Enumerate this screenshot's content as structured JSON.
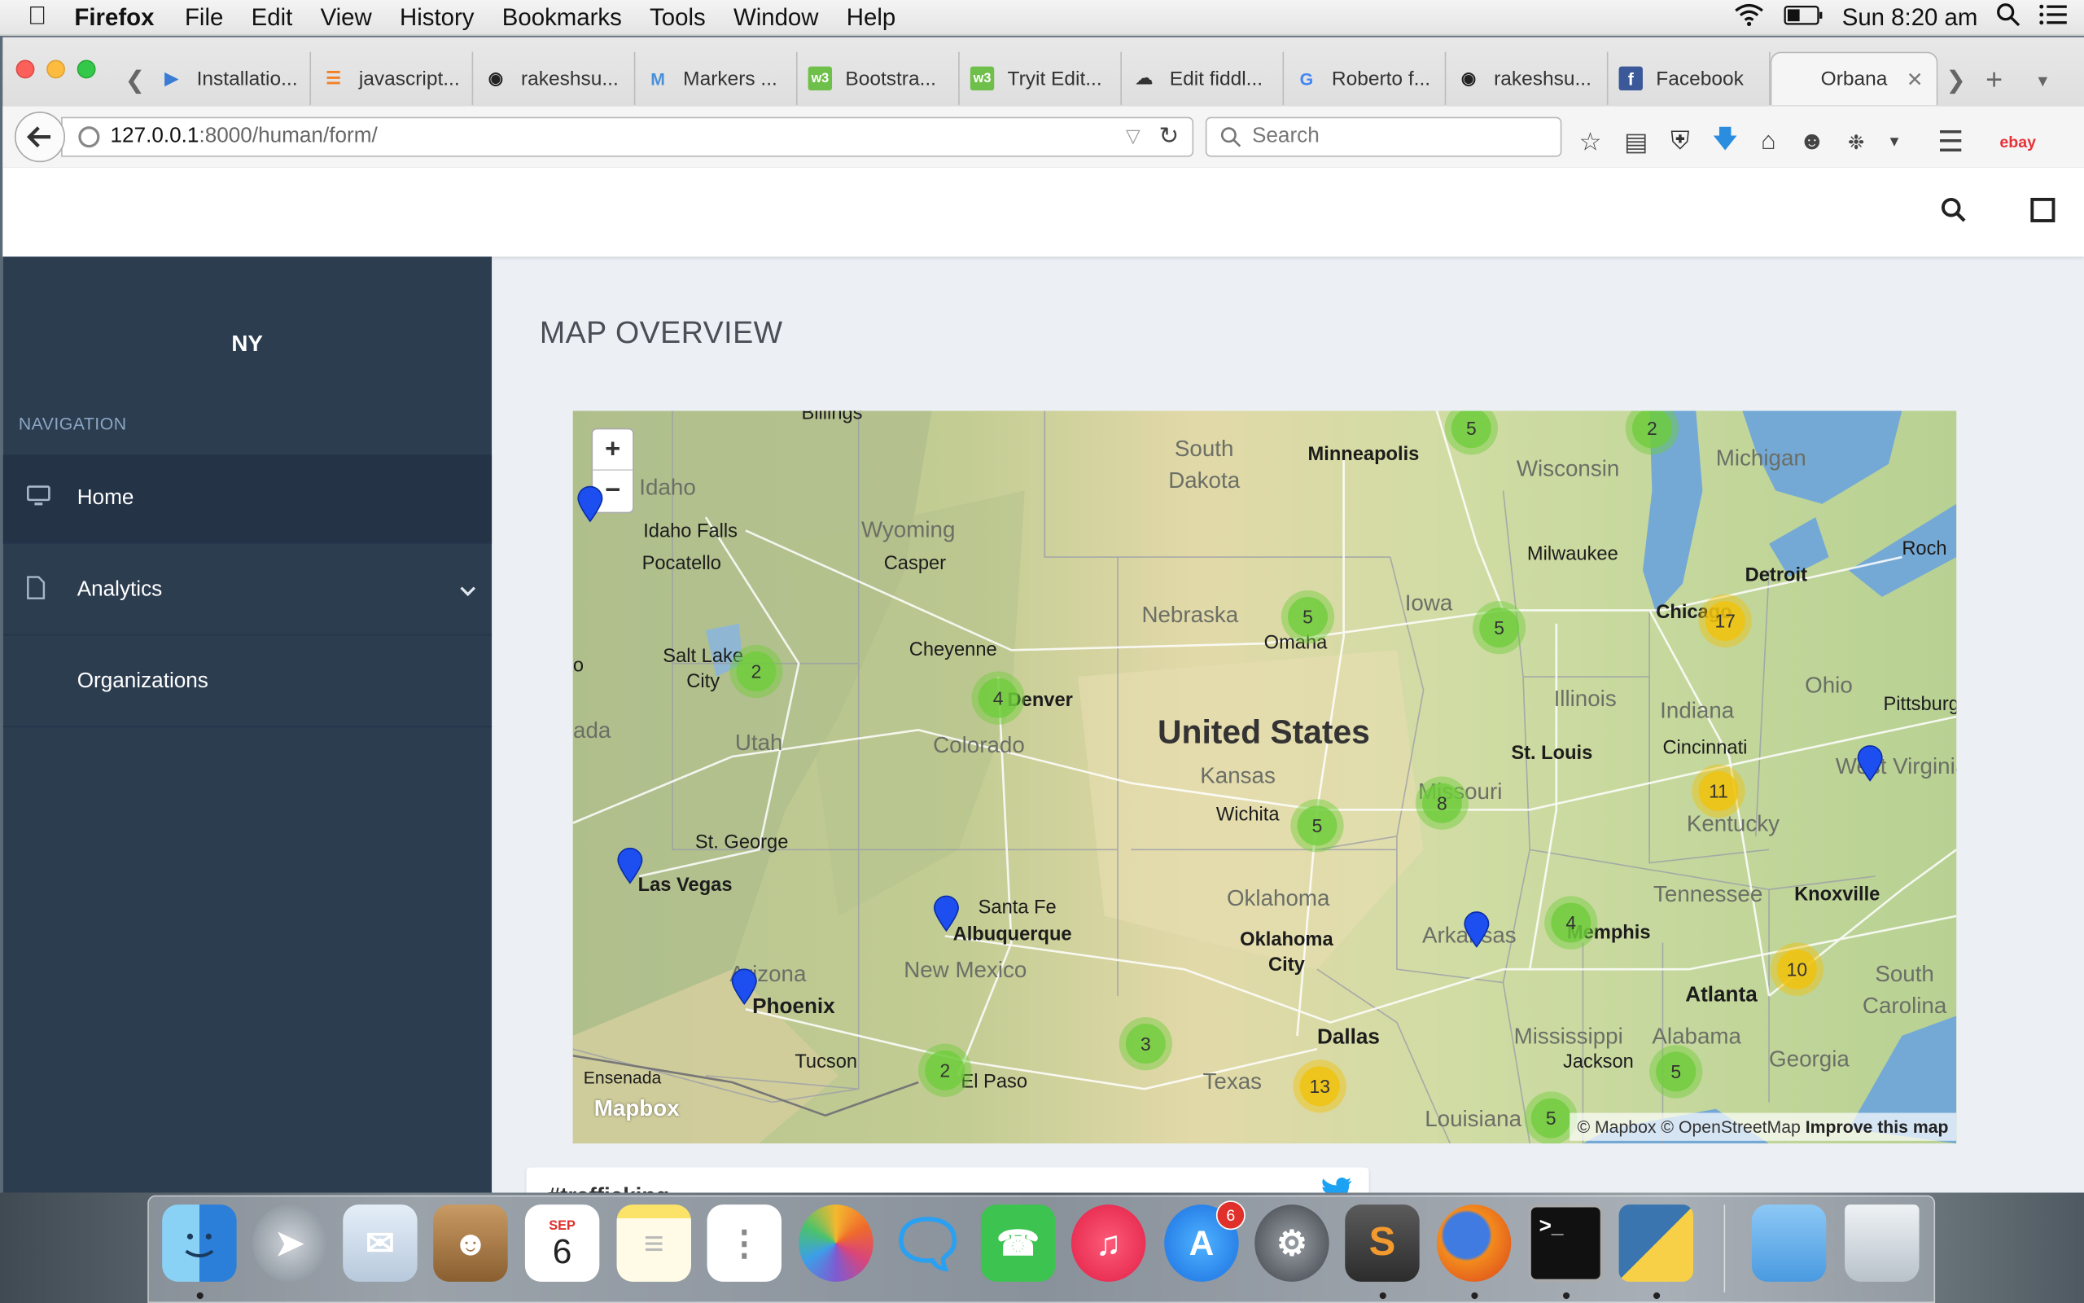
{
  "menubar": {
    "app": "Firefox",
    "items": [
      "File",
      "Edit",
      "View",
      "History",
      "Bookmarks",
      "Tools",
      "Window",
      "Help"
    ],
    "clock": "Sun 8:20 am"
  },
  "browser": {
    "tabs": [
      {
        "label": "Installatio...",
        "icon": "doc-icon",
        "color": "#3a7bd5"
      },
      {
        "label": "javascript...",
        "icon": "stackoverflow-icon",
        "color": "#f48024"
      },
      {
        "label": "rakeshsu...",
        "icon": "github-icon",
        "color": "#222"
      },
      {
        "label": "Markers ...",
        "icon": "m-icon",
        "color": "#4a90d9"
      },
      {
        "label": "Bootstra...",
        "icon": "w3-icon",
        "color": "#6fc04a"
      },
      {
        "label": "Tryit Edit...",
        "icon": "w3-icon",
        "color": "#6fc04a"
      },
      {
        "label": "Edit fiddl...",
        "icon": "cloud-icon",
        "color": "#333"
      },
      {
        "label": "Roberto f...",
        "icon": "google-icon",
        "color": "#4285f4"
      },
      {
        "label": "rakeshsu...",
        "icon": "github-icon",
        "color": "#222"
      },
      {
        "label": "Facebook",
        "icon": "facebook-icon",
        "color": "#3b5998"
      }
    ],
    "active_tab": "Orbana",
    "url_host": "127.0.0.1",
    "url_path": ":8000/human/form/",
    "search_placeholder": "Search"
  },
  "app": {
    "brand": "NY",
    "nav_header": "NAVIGATION",
    "nav": [
      {
        "label": "Home",
        "icon": "monitor-icon"
      },
      {
        "label": "Analytics",
        "icon": "file-icon"
      },
      {
        "label": "Organizations",
        "icon": ""
      }
    ],
    "page_title": "MAP OVERVIEW"
  },
  "map": {
    "state_labels": [
      "Idaho",
      "Wyoming",
      "South Dakota",
      "Nebraska",
      "Iowa",
      "Wisconsin",
      "Michigan",
      "Illinois",
      "Indiana",
      "Ohio",
      "Utah",
      "Colorado",
      "Kansas",
      "Missouri",
      "Kentucky",
      "Tennessee",
      "Oklahoma",
      "Arkansas",
      "Arizona",
      "New Mexico",
      "Texas",
      "Mississippi",
      "Alabama",
      "Georgia",
      "South Carolina",
      "Louisiana",
      "Nevada",
      "West Virginia"
    ],
    "cities": [
      "Billings",
      "Minneapolis",
      "Idaho Falls",
      "Pocatello",
      "Casper",
      "Milwaukee",
      "Detroit",
      "Chicago",
      "Cheyenne",
      "Omaha",
      "Salt Lake City",
      "Denver",
      "St. Louis",
      "Cincinnati",
      "Pittsburgh",
      "Wichita",
      "St. George",
      "Las Vegas",
      "Santa Fe",
      "Albuquerque",
      "Knoxville",
      "Memphis",
      "Oklahoma City",
      "Atlanta",
      "Phoenix",
      "Dallas",
      "Jackson",
      "Tucson",
      "El Paso",
      "Ensenada",
      "Roch",
      "Elko"
    ],
    "country_label": "United States",
    "clusters": [
      {
        "count": "5",
        "level": "low"
      },
      {
        "count": "2",
        "level": "low"
      },
      {
        "count": "5",
        "level": "low"
      },
      {
        "count": "5",
        "level": "low"
      },
      {
        "count": "17",
        "level": "mid"
      },
      {
        "count": "2",
        "level": "low"
      },
      {
        "count": "4",
        "level": "low"
      },
      {
        "count": "8",
        "level": "low"
      },
      {
        "count": "5",
        "level": "low"
      },
      {
        "count": "11",
        "level": "mid"
      },
      {
        "count": "4",
        "level": "low"
      },
      {
        "count": "10",
        "level": "mid"
      },
      {
        "count": "3",
        "level": "low"
      },
      {
        "count": "2",
        "level": "low"
      },
      {
        "count": "13",
        "level": "mid"
      },
      {
        "count": "5",
        "level": "low"
      },
      {
        "count": "5",
        "level": "low"
      }
    ],
    "logo": "Mapbox",
    "attribution": [
      "© Mapbox",
      "© OpenStreetMap",
      "Improve this map"
    ],
    "zoom_in": "+",
    "zoom_out": "−"
  },
  "card": {
    "title": "#trafficking"
  },
  "dock": {
    "calendar_month": "SEP",
    "calendar_day": "6",
    "appstore_badge": "6"
  }
}
